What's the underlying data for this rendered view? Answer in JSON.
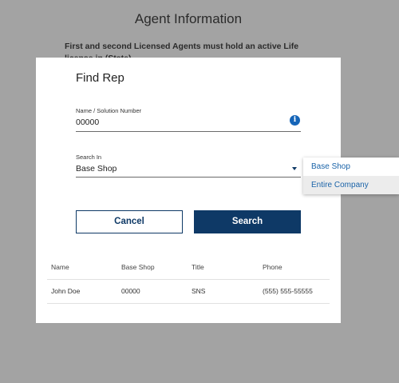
{
  "background": {
    "title": "Agent Information",
    "notice": "First and second Licensed Agents must hold an active Life license in (State)"
  },
  "modal": {
    "title": "Find Rep",
    "name_field": {
      "label": "Name / Solution Number",
      "value": "00000",
      "icon": "info-icon"
    },
    "search_in": {
      "label": "Search In",
      "value": "Base Shop",
      "icon": "chevron-down-icon"
    },
    "cancel_label": "Cancel",
    "search_label": "Search",
    "results": {
      "columns": [
        "Name",
        "Base Shop",
        "Title",
        "Phone"
      ],
      "rows": [
        {
          "name": "John Doe",
          "base_shop": "00000",
          "title": "SNS",
          "phone": "(555) 555-55555"
        }
      ]
    }
  },
  "dropdown": {
    "options": [
      "Base Shop",
      "Entire Company"
    ],
    "highlighted": "Entire Company"
  },
  "colors": {
    "primary": "#0e3966",
    "link": "#1a63a8",
    "info": "#1665b8",
    "overlay": "#a3a3a3"
  }
}
